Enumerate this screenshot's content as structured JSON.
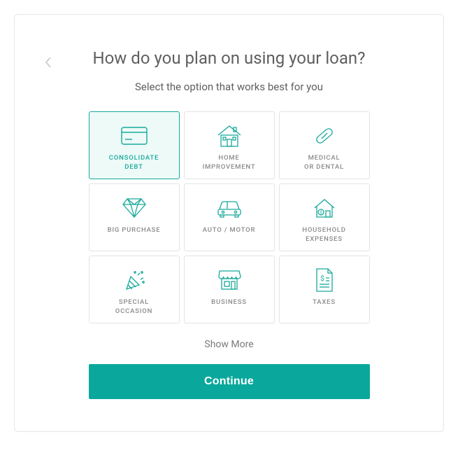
{
  "heading": "How do you plan on using your loan?",
  "subtitle": "Select the option that works best for you",
  "options": [
    {
      "label": "CONSOLIDATE\nDEBT",
      "icon": "credit-card-icon",
      "selected": true
    },
    {
      "label": "HOME\nIMPROVEMENT",
      "icon": "house-icon",
      "selected": false
    },
    {
      "label": "MEDICAL\nOR DENTAL",
      "icon": "pill-icon",
      "selected": false
    },
    {
      "label": "BIG PURCHASE",
      "icon": "diamond-icon",
      "selected": false
    },
    {
      "label": "AUTO / MOTOR",
      "icon": "car-icon",
      "selected": false
    },
    {
      "label": "HOUSEHOLD\nEXPENSES",
      "icon": "home-coin-icon",
      "selected": false
    },
    {
      "label": "SPECIAL\nOCCASION",
      "icon": "party-icon",
      "selected": false
    },
    {
      "label": "BUSINESS",
      "icon": "shop-icon",
      "selected": false
    },
    {
      "label": "TAXES",
      "icon": "tax-doc-icon",
      "selected": false
    }
  ],
  "show_more_label": "Show More",
  "continue_label": "Continue",
  "colors": {
    "accent": "#0aa89c",
    "accent2": "#18a99b"
  }
}
